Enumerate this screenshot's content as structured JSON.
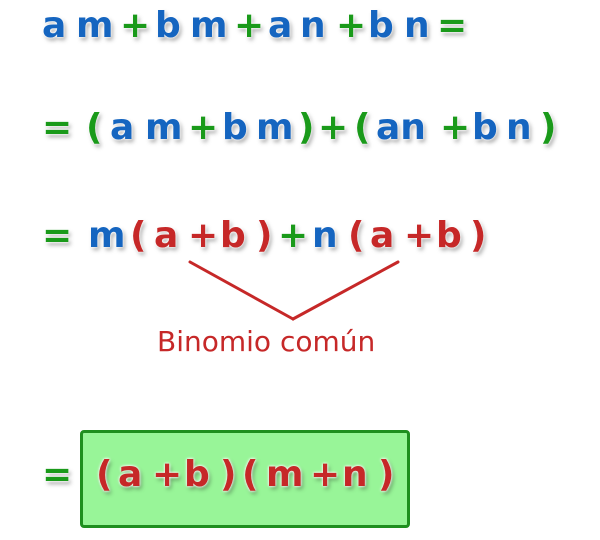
{
  "equation": {
    "line1": [
      "a",
      "m",
      "+",
      "b",
      "m",
      "+",
      "a",
      "n",
      "+",
      "b",
      "n",
      "="
    ],
    "line2": [
      "=",
      "(",
      "a",
      "m",
      "+",
      "b",
      "m",
      ")",
      "+",
      "(",
      "an",
      "+",
      "b",
      "n",
      ")"
    ],
    "line3": [
      "=",
      "m",
      "(",
      "a",
      "+",
      "b",
      ")",
      "+",
      "n",
      "(",
      "a",
      "+",
      "b",
      ")"
    ],
    "line4": [
      "=",
      "(",
      "a",
      "+",
      "b",
      ")",
      "(",
      "m",
      "+",
      "n",
      ")"
    ]
  },
  "annotation": {
    "common_binomial_label": "Binomio común"
  },
  "colors": {
    "variable": "#1565c0",
    "operator": "#1a9a1a",
    "highlight": "#c62828",
    "result_box_fill": "#98f598",
    "result_box_border": "#1f8f1f"
  }
}
